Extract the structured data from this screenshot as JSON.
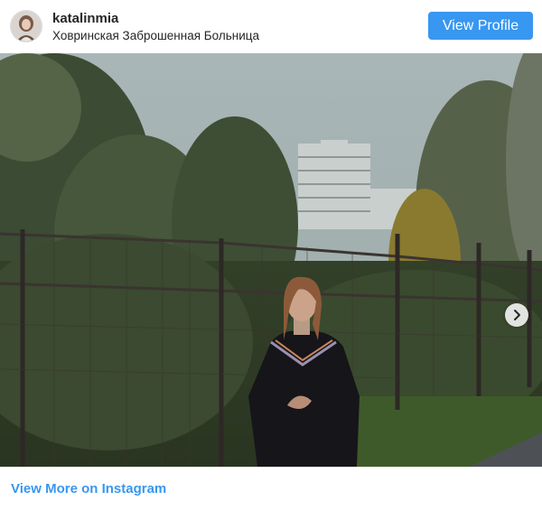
{
  "post": {
    "username": "katalinmia",
    "location": "Ховринская Заброшенная Больница",
    "view_profile_label": "View Profile",
    "view_more_label": "View More on Instagram"
  },
  "icons": {
    "next": "chevron-right-icon",
    "avatar": "profile-photo"
  },
  "colors": {
    "accent": "#3897f0",
    "text": "#262626"
  }
}
